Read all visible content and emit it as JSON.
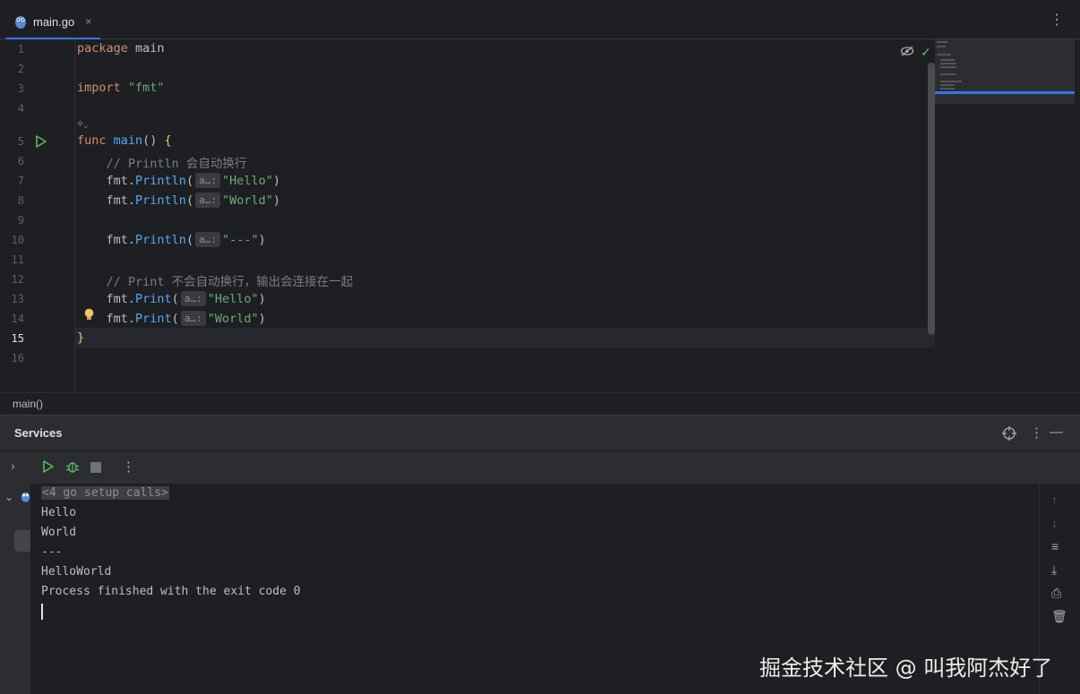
{
  "tab": {
    "filename": "main.go",
    "close": "×",
    "more": "⋮"
  },
  "editor": {
    "line_numbers": [
      "1",
      "2",
      "3",
      "4",
      "5",
      "6",
      "7",
      "8",
      "9",
      "10",
      "11",
      "12",
      "13",
      "14",
      "15",
      "16"
    ],
    "lines": {
      "l1_kw": "package",
      "l1_rest": " main",
      "l3_kw": "import",
      "l3_str": " \"fmt\"",
      "l5_kw": "func",
      "l5_fn": " main",
      "l5_rest": "() ",
      "l5_brace": "{",
      "l6": "    // Println 会自动换行",
      "l7_pre": "    fmt.",
      "l7_fn": "Println",
      "l7_open": "(",
      "l7_hint": "a…:",
      "l7_str": "\"Hello\"",
      "l7_close": ")",
      "l8_pre": "    fmt.",
      "l8_fn": "Println",
      "l8_open": "(",
      "l8_hint": "a…:",
      "l8_str": "\"World\"",
      "l8_close": ")",
      "l10_pre": "    fmt.",
      "l10_fn": "Println",
      "l10_open": "(",
      "l10_hint": "a…:",
      "l10_str": "\"---\"",
      "l10_close": ")",
      "l12": "    // Print 不会自动换行，输出会连接在一起",
      "l13_pre": "    fmt.",
      "l13_fn": "Print",
      "l13_open": "(",
      "l13_hint": "a…:",
      "l13_str": "\"Hello\"",
      "l13_close": ")",
      "l14_pre": "    fmt.",
      "l14_fn": "Print",
      "l14_open": "(",
      "l14_hint": "a…:",
      "l14_str": "\"World\"",
      "l14_close": ")",
      "l15": "}"
    },
    "current_line": "15"
  },
  "breadcrumb": "main()",
  "services": {
    "title": "Services",
    "console_lines": [
      "Hello",
      "World",
      "---",
      "HelloWorld",
      "Process finished with the exit code 0"
    ],
    "setup_calls": "<4 go setup calls>"
  },
  "watermark": "掘金技术社区 @ 叫我阿杰好了",
  "colors": {
    "accent": "#3574f0",
    "run_green": "#5fb865",
    "keyword": "#cf8e6d",
    "string": "#6aab73",
    "function": "#56a8f5"
  }
}
